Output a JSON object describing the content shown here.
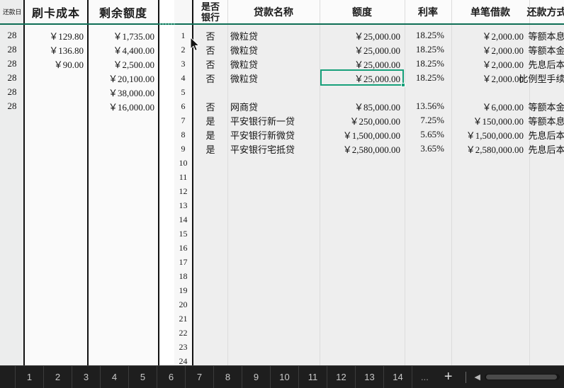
{
  "left_table": {
    "headers": [
      "还款日",
      "刷卡成本",
      "剩余额度"
    ],
    "rows": [
      {
        "day": "28",
        "cost": "￥129.80",
        "quota": "￥1,735.00"
      },
      {
        "day": "28",
        "cost": "￥136.80",
        "quota": "￥4,400.00"
      },
      {
        "day": "28",
        "cost": "￥90.00",
        "quota": "￥2,500.00"
      },
      {
        "day": "28",
        "cost": "",
        "quota": "￥20,100.00"
      },
      {
        "day": "28",
        "cost": "",
        "quota": "￥38,000.00"
      },
      {
        "day": "28",
        "cost": "",
        "quota": "￥16,000.00"
      }
    ]
  },
  "right_table": {
    "headers": {
      "is_bank_line1": "是否",
      "is_bank_line2": "银行",
      "loan_name": "贷款名称",
      "amount": "额度",
      "rate": "利率",
      "single_loan": "单笔借款",
      "repayment": "还款方式"
    },
    "rows": [
      {
        "num": "1",
        "is_bank": "否",
        "loan_name": "微粒贷",
        "amount": "￥25,000.00",
        "rate": "18.25%",
        "single_loan": "￥2,000.00",
        "repayment": "等额本息"
      },
      {
        "num": "2",
        "is_bank": "否",
        "loan_name": "微粒贷",
        "amount": "￥25,000.00",
        "rate": "18.25%",
        "single_loan": "￥2,000.00",
        "repayment": "等额本金"
      },
      {
        "num": "3",
        "is_bank": "否",
        "loan_name": "微粒贷",
        "amount": "￥25,000.00",
        "rate": "18.25%",
        "single_loan": "￥2,000.00",
        "repayment": "先息后本"
      },
      {
        "num": "4",
        "is_bank": "否",
        "loan_name": "微粒贷",
        "amount": "￥25,000.00",
        "rate": "18.25%",
        "single_loan": "￥2,000.00",
        "repayment": "比例型手续费"
      },
      {
        "num": "5",
        "is_bank": "",
        "loan_name": "",
        "amount": "",
        "rate": "",
        "single_loan": "",
        "repayment": ""
      },
      {
        "num": "6",
        "is_bank": "否",
        "loan_name": "网商贷",
        "amount": "￥85,000.00",
        "rate": "13.56%",
        "single_loan": "￥6,000.00",
        "repayment": "等额本金"
      },
      {
        "num": "7",
        "is_bank": "是",
        "loan_name": "平安银行新一贷",
        "amount": "￥250,000.00",
        "rate": "7.25%",
        "single_loan": "￥150,000.00",
        "repayment": "等额本息"
      },
      {
        "num": "8",
        "is_bank": "是",
        "loan_name": "平安银行新微贷",
        "amount": "￥1,500,000.00",
        "rate": "5.65%",
        "single_loan": "￥1,500,000.00",
        "repayment": "先息后本"
      },
      {
        "num": "9",
        "is_bank": "是",
        "loan_name": "平安银行宅抵贷",
        "amount": "￥2,580,000.00",
        "rate": "3.65%",
        "single_loan": "￥2,580,000.00",
        "repayment": "先息后本"
      },
      {
        "num": "10",
        "is_bank": "",
        "loan_name": "",
        "amount": "",
        "rate": "",
        "single_loan": "",
        "repayment": ""
      },
      {
        "num": "11",
        "is_bank": "",
        "loan_name": "",
        "amount": "",
        "rate": "",
        "single_loan": "",
        "repayment": ""
      },
      {
        "num": "12",
        "is_bank": "",
        "loan_name": "",
        "amount": "",
        "rate": "",
        "single_loan": "",
        "repayment": ""
      },
      {
        "num": "13",
        "is_bank": "",
        "loan_name": "",
        "amount": "",
        "rate": "",
        "single_loan": "",
        "repayment": ""
      },
      {
        "num": "14",
        "is_bank": "",
        "loan_name": "",
        "amount": "",
        "rate": "",
        "single_loan": "",
        "repayment": ""
      },
      {
        "num": "15",
        "is_bank": "",
        "loan_name": "",
        "amount": "",
        "rate": "",
        "single_loan": "",
        "repayment": ""
      },
      {
        "num": "16",
        "is_bank": "",
        "loan_name": "",
        "amount": "",
        "rate": "",
        "single_loan": "",
        "repayment": ""
      },
      {
        "num": "17",
        "is_bank": "",
        "loan_name": "",
        "amount": "",
        "rate": "",
        "single_loan": "",
        "repayment": ""
      },
      {
        "num": "18",
        "is_bank": "",
        "loan_name": "",
        "amount": "",
        "rate": "",
        "single_loan": "",
        "repayment": ""
      },
      {
        "num": "19",
        "is_bank": "",
        "loan_name": "",
        "amount": "",
        "rate": "",
        "single_loan": "",
        "repayment": ""
      },
      {
        "num": "20",
        "is_bank": "",
        "loan_name": "",
        "amount": "",
        "rate": "",
        "single_loan": "",
        "repayment": ""
      },
      {
        "num": "21",
        "is_bank": "",
        "loan_name": "",
        "amount": "",
        "rate": "",
        "single_loan": "",
        "repayment": ""
      },
      {
        "num": "22",
        "is_bank": "",
        "loan_name": "",
        "amount": "",
        "rate": "",
        "single_loan": "",
        "repayment": ""
      },
      {
        "num": "23",
        "is_bank": "",
        "loan_name": "",
        "amount": "",
        "rate": "",
        "single_loan": "",
        "repayment": ""
      },
      {
        "num": "24",
        "is_bank": "",
        "loan_name": "",
        "amount": "",
        "rate": "",
        "single_loan": "",
        "repayment": ""
      }
    ],
    "selection": {
      "row": "4",
      "column": "额度",
      "value": "￥25,000.00"
    }
  },
  "tabbar": {
    "tabs": [
      "",
      "1",
      "2",
      "3",
      "4",
      "5",
      "6",
      "7",
      "8",
      "9",
      "10",
      "11",
      "12",
      "13",
      "14"
    ],
    "ellipsis_label": "...",
    "add_label": "+",
    "scroll_left_icon": "scroll-left-icon"
  },
  "colors": {
    "accent_selection": "#17a07a",
    "header_rule": "#0e6e55",
    "grid_border": "#111111",
    "tabbar_bg": "#1e1e1e"
  }
}
